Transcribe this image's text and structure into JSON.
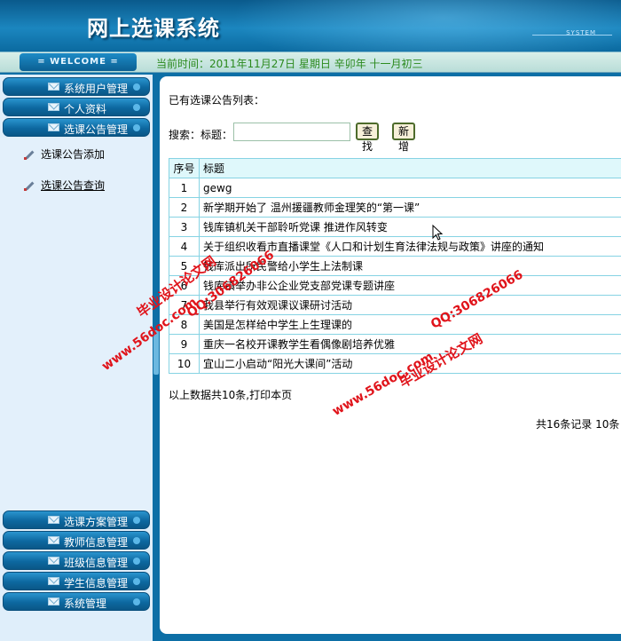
{
  "header": {
    "title": "网上选课系统",
    "system_label": "SYSTEM"
  },
  "welcome_bar": {
    "welcome": "= WELCOME =",
    "current_time": "当前时间：2011年11月27日 星期日 辛卯年 十一月初三"
  },
  "sidebar": {
    "top_items": [
      {
        "label": "系统用户管理"
      },
      {
        "label": "个人资料"
      },
      {
        "label": "选课公告管理"
      }
    ],
    "sub_items": [
      {
        "label": "选课公告添加"
      },
      {
        "label": "选课公告查询"
      }
    ],
    "bottom_items": [
      {
        "label": "选课方案管理"
      },
      {
        "label": "教师信息管理"
      },
      {
        "label": "班级信息管理"
      },
      {
        "label": "学生信息管理"
      },
      {
        "label": "系统管理"
      }
    ]
  },
  "main": {
    "heading": "已有选课公告列表：",
    "search": {
      "label": "搜索：",
      "field_label": "标题：",
      "value": "",
      "search_button": "查找",
      "add_button": "新增"
    },
    "table": {
      "headers": [
        "序号",
        "标题"
      ],
      "rows": [
        {
          "no": "1",
          "title": "gewg"
        },
        {
          "no": "2",
          "title": "新学期开始了 温州援疆教师金理笑的“第一课”"
        },
        {
          "no": "3",
          "title": "钱库镇机关干部聆听党课 推进作风转变"
        },
        {
          "no": "4",
          "title": "关于组织收看市直播课堂《人口和计划生育法律法规与政策》讲座的通知"
        },
        {
          "no": "5",
          "title": "钱库派出所民警给小学生上法制课"
        },
        {
          "no": "6",
          "title": "钱库镇举办非公企业党支部党课专题讲座"
        },
        {
          "no": "7",
          "title": "我县举行有效观课议课研讨活动"
        },
        {
          "no": "8",
          "title": "美国是怎样给中学生上生理课的"
        },
        {
          "no": "9",
          "title": "重庆一名校开课教学生看偶像剧培养优雅"
        },
        {
          "no": "10",
          "title": "宜山二小启动“阳光大课间”活动"
        }
      ]
    },
    "summary": "以上数据共10条,打印本页",
    "pager": "共16条记录   10条"
  },
  "watermarks": {
    "brand": "毕业设计论文网",
    "site": "www.56doc.com",
    "qq": "QQ:306826066"
  },
  "colors": {
    "header_blue": "#0b6aa0",
    "table_border": "#86d3e3",
    "table_header_bg": "#dff8fb",
    "time_green": "#2b8a1e",
    "watermark_red": "#e0141b"
  }
}
